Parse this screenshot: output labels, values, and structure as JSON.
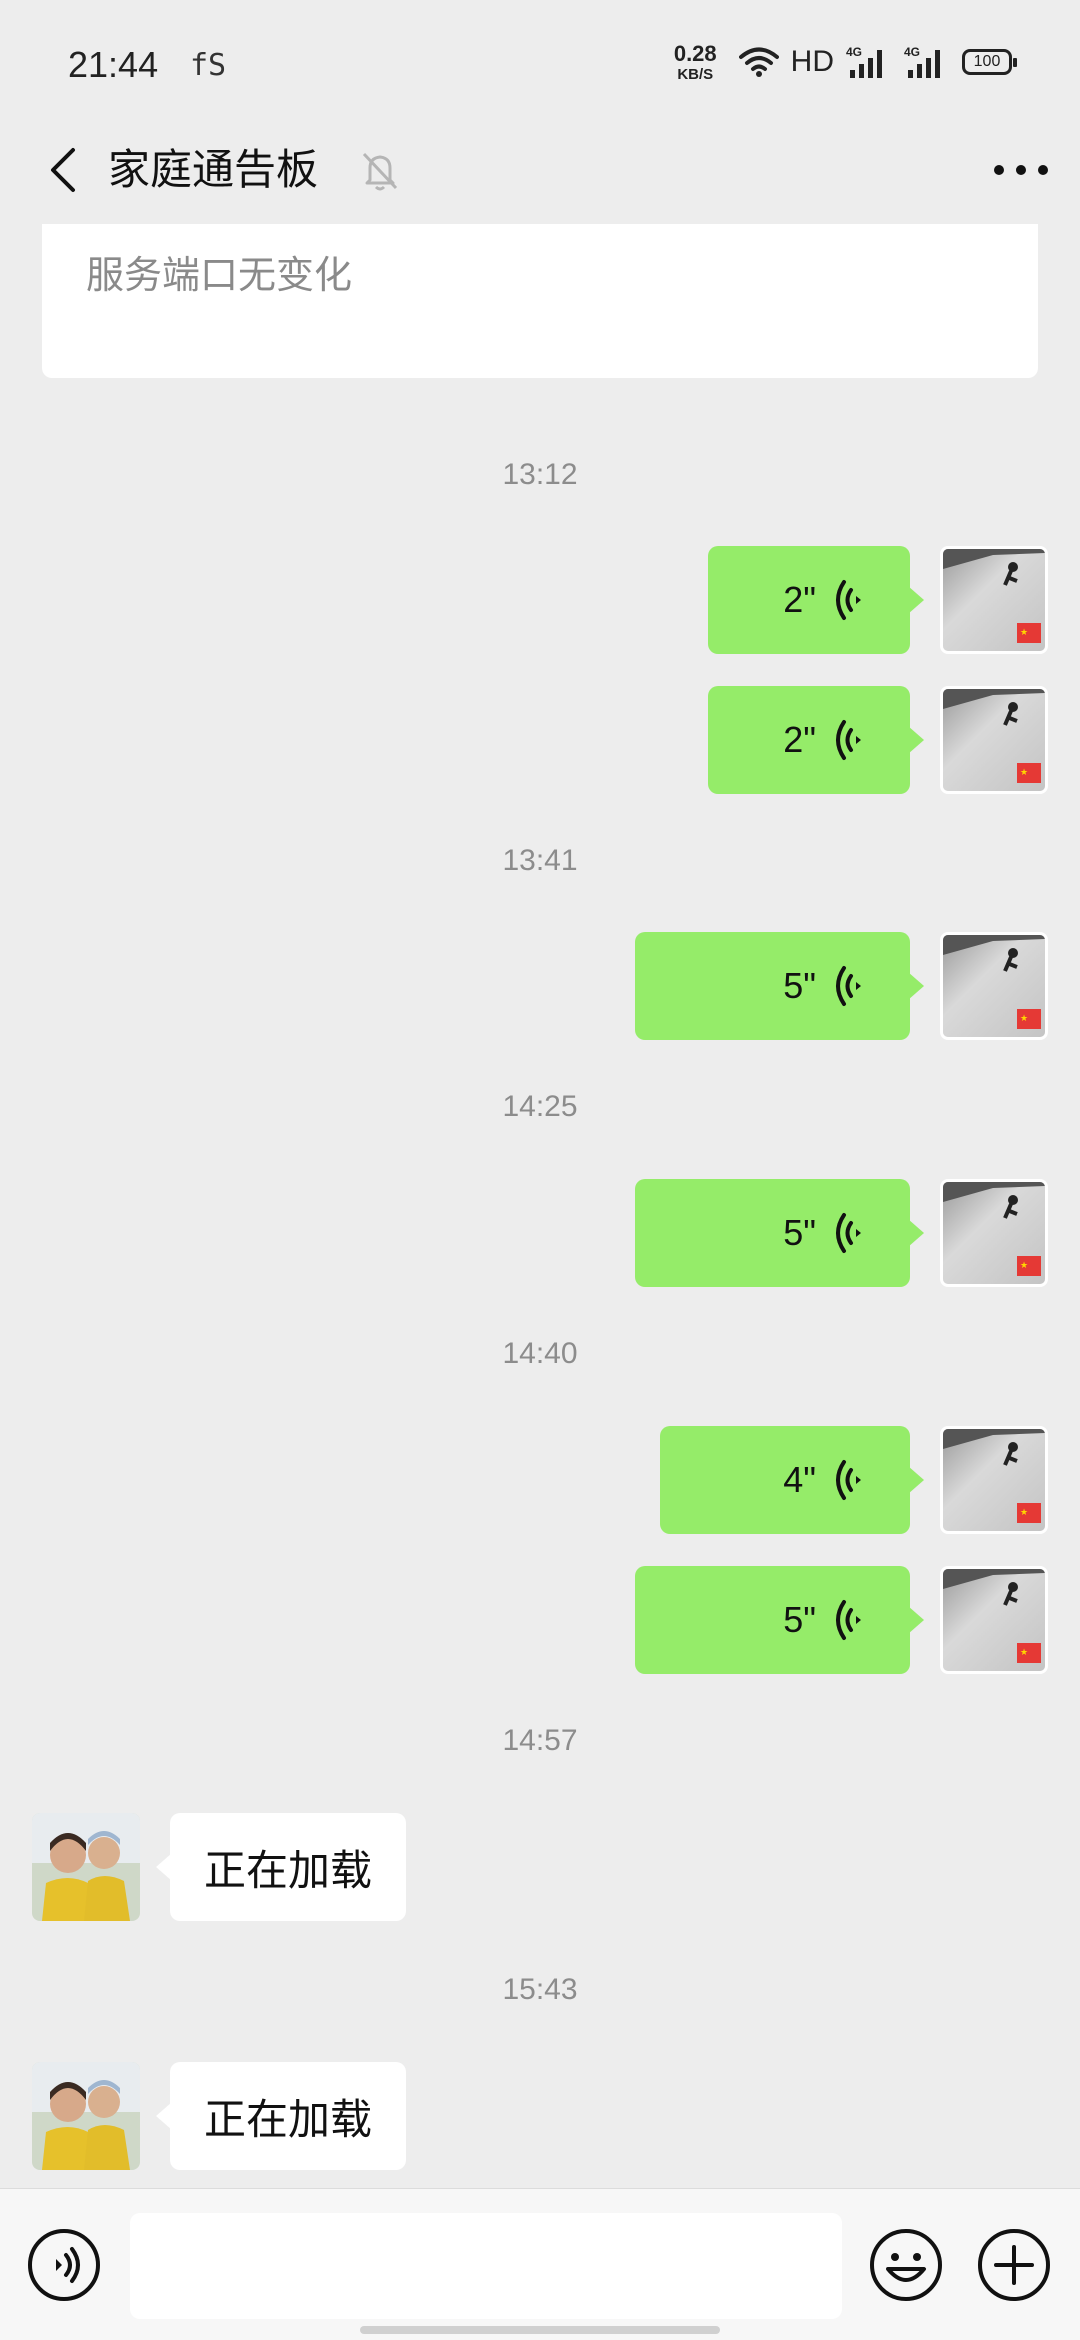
{
  "status_bar": {
    "time": "21:44",
    "app_indicator": "fS",
    "net_speed_value": "0.28",
    "net_speed_unit": "KB/S",
    "hd_label": "HD",
    "network_1": "4G",
    "network_2": "4G",
    "battery": "100"
  },
  "nav": {
    "title": "家庭通告板",
    "back_icon": "chevron-left-icon",
    "mute_icon": "bell-muted-icon",
    "more_icon": "more-dots-icon"
  },
  "notice": {
    "text": "服务端口无变化"
  },
  "messages": [
    {
      "type": "time",
      "text": "13:12"
    },
    {
      "type": "voice",
      "side": "right",
      "duration": "2\""
    },
    {
      "type": "voice",
      "side": "right",
      "duration": "2\""
    },
    {
      "type": "time",
      "text": "13:41"
    },
    {
      "type": "voice",
      "side": "right",
      "duration": "5\""
    },
    {
      "type": "time",
      "text": "14:25"
    },
    {
      "type": "voice",
      "side": "right",
      "duration": "5\""
    },
    {
      "type": "time",
      "text": "14:40"
    },
    {
      "type": "voice",
      "side": "right",
      "duration": "4\""
    },
    {
      "type": "voice",
      "side": "right",
      "duration": "5\""
    },
    {
      "type": "time",
      "text": "14:57"
    },
    {
      "type": "text",
      "side": "left",
      "text": "正在加载"
    },
    {
      "type": "time",
      "text": "15:43"
    },
    {
      "type": "text",
      "side": "left",
      "text": "正在加载"
    }
  ],
  "input_bar": {
    "voice_icon": "voice-mode-icon",
    "emoji_icon": "emoji-icon",
    "plus_icon": "plus-icon",
    "placeholder": ""
  },
  "colors": {
    "background": "#ededed",
    "self_bubble": "#95ec69",
    "other_bubble": "#ffffff",
    "timestamp": "#8c8c8c"
  }
}
